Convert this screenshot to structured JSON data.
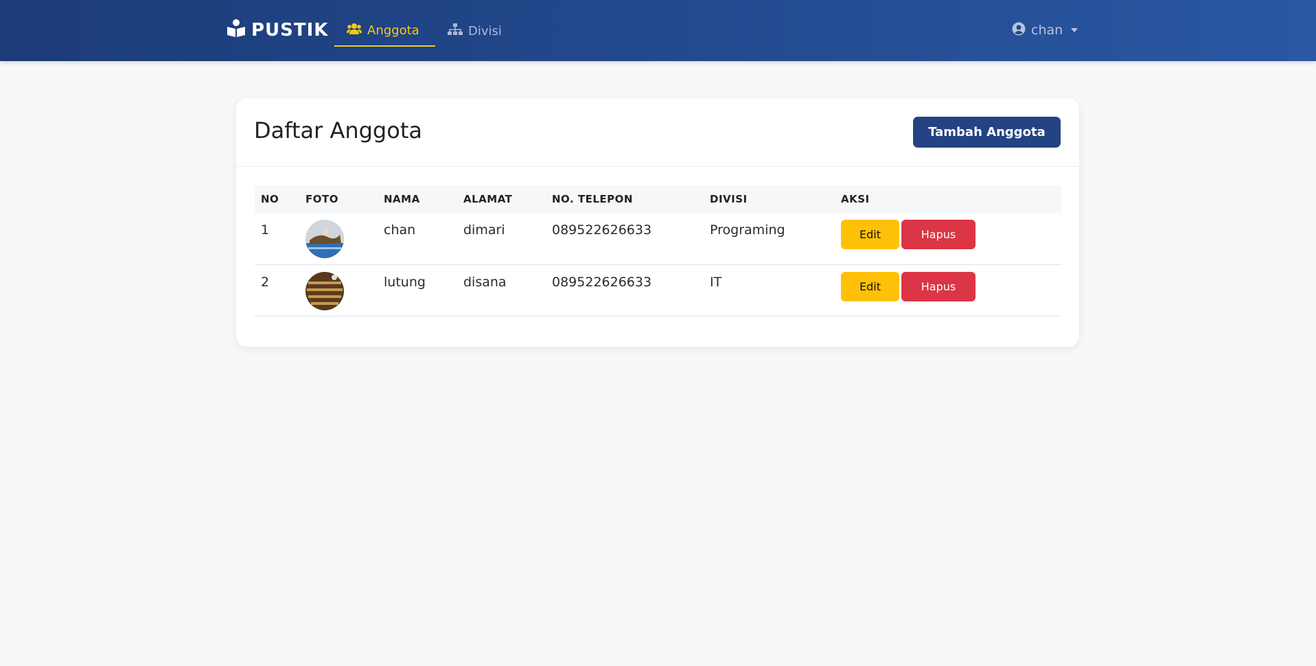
{
  "navbar": {
    "brand": "PUSTIK",
    "links": [
      {
        "label": "Anggota",
        "active": true,
        "icon": "users-icon"
      },
      {
        "label": "Divisi",
        "active": false,
        "icon": "sitemap-icon"
      }
    ],
    "user": {
      "name": "chan",
      "icon": "user-circle-icon"
    }
  },
  "card": {
    "title": "Daftar Anggota",
    "add_button": "Tambah Anggota"
  },
  "table": {
    "headers": [
      "NO",
      "FOTO",
      "NAMA",
      "ALAMAT",
      "NO. TELEPON",
      "DIVISI",
      "AKSI"
    ],
    "rows": [
      {
        "no": "1",
        "nama": "chan",
        "alamat": "dimari",
        "telepon": "089522626633",
        "divisi": "Programing",
        "edit": "Edit",
        "hapus": "Hapus"
      },
      {
        "no": "2",
        "nama": "lutung",
        "alamat": "disana",
        "telepon": "089522626633",
        "divisi": "IT",
        "edit": "Edit",
        "hapus": "Hapus"
      }
    ]
  },
  "colors": {
    "navbar": "#234a8f",
    "active": "#f6c915",
    "primary_button": "#234383",
    "warning": "#ffc107",
    "danger": "#dc3545"
  }
}
